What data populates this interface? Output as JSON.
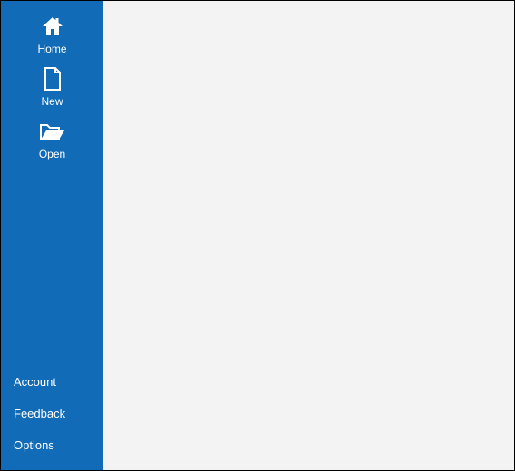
{
  "sidebar": {
    "top": [
      {
        "label": "Home"
      },
      {
        "label": "New"
      },
      {
        "label": "Open"
      }
    ],
    "bottom": [
      {
        "label": "Account"
      },
      {
        "label": "Feedback"
      },
      {
        "label": "Options"
      }
    ]
  }
}
